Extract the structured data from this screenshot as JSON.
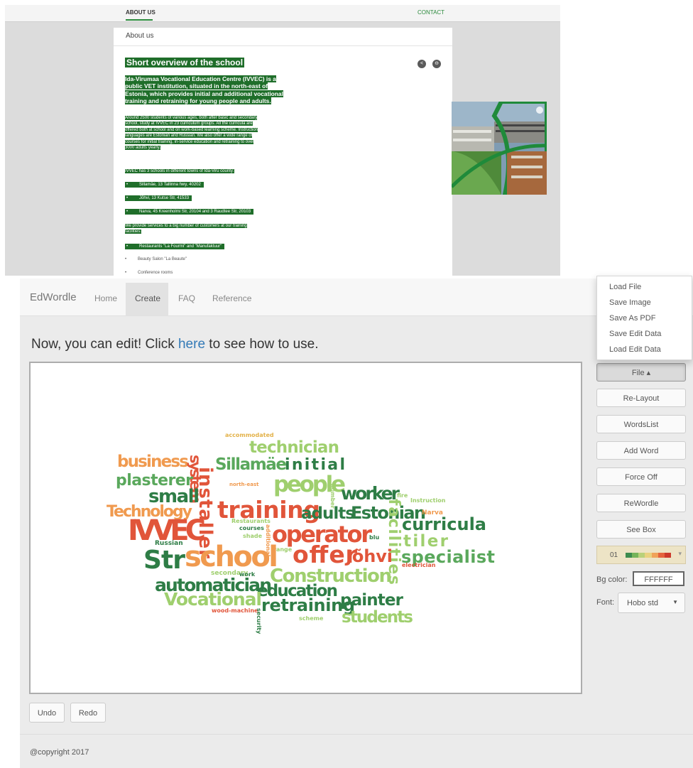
{
  "school_page": {
    "nav": {
      "about": "ABOUT US",
      "contact": "CONTACT"
    },
    "card_title": "About us",
    "heading": "Short overview of the school",
    "intro": [
      "Ida-Virumaa Vocational Education Centre (IVVEC) is a",
      "public VET institution, situated in the north-east of",
      "Estonia, which provides initial and additional vocational",
      "training and retraining for young people and adults."
    ],
    "paragraph1": [
      "Around 2500 students of various ages, both after basic and secondary",
      "school, study at IVVEC in 23 curriculum groups. All the curricula are",
      "offered both at school and on work-based learning scheme. Instruction",
      "languages are Estonian and Russian. We also offer a wide range of",
      "courses for initial training, in-service education and retraining to over",
      "3000 adults yearly."
    ],
    "schools_intro": "IVVEC has 3 schools in different towns of Ida-Viru county:",
    "schools": [
      "Sillamäe, 13 Tallinna hwy, 40202",
      "Jõhvi, 13 Kutse Str, 41533",
      "Narva, 45 Kreenholmi Str, 20104 and 3 Raudtee Str, 20103"
    ],
    "services_intro": [
      "We provide services to a big number of customers at our training",
      "facilities:"
    ],
    "services": [
      "Restaurants \"La Fourmi\" and \"Manufaktuur\"",
      "Beauty Salon \"La Beaute\"",
      "Conference rooms"
    ],
    "bullet": "•"
  },
  "edwordle": {
    "brand": "EdWordle",
    "nav": [
      "Home",
      "Create",
      "FAQ",
      "Reference"
    ],
    "active_nav": "Create",
    "lead_before": "Now, you can edit! Click ",
    "lead_link": "here",
    "lead_after": " to see how to use.",
    "file_menu": [
      "Load File",
      "Save Image",
      "Save As PDF",
      "Save Edit Data",
      "Load Edit Data"
    ],
    "buttons": {
      "file": "File ▴",
      "relayout": "Re-Layout",
      "wordslist": "WordsList",
      "add_word": "Add Word",
      "force_off": "Force Off",
      "rewordle": "ReWordle",
      "see_box": "See Box"
    },
    "palette": {
      "number": "01",
      "colors": [
        "#3d8c4f",
        "#76b45a",
        "#b9d17a",
        "#e9d27f",
        "#f0a35a",
        "#e4643e",
        "#cc3a2c"
      ],
      "caret": "▾"
    },
    "bg_color_label": "Bg color:",
    "bg_color_value": "FFFFFF",
    "font_label": "Font:",
    "font_value": "Hobo std",
    "font_caret": "▼",
    "undo": "Undo",
    "redo": "Redo",
    "copyright": "@copyright 2017",
    "word_colors": {
      "dark_green": "#2e7d46",
      "green": "#5aa85c",
      "light_green": "#9fcf6e",
      "orange": "#f09a4f",
      "red_orange": "#e1553a",
      "red": "#cc3b2b",
      "amber": "#e3b24a"
    },
    "words": [
      {
        "text": "accommodated",
        "color": "#e3b24a"
      },
      {
        "text": "technician",
        "color": "#9fcf6e"
      },
      {
        "text": "business",
        "color": "#f09a4f"
      },
      {
        "text": "system",
        "color": "#e1553a"
      },
      {
        "text": "Sillamäe",
        "color": "#5aa85c"
      },
      {
        "text": "initial",
        "color": "#2e7d46"
      },
      {
        "text": "plasterer",
        "color": "#5aa85c"
      },
      {
        "text": "installer",
        "color": "#e1553a"
      },
      {
        "text": "north-east",
        "color": "#f09a4f"
      },
      {
        "text": "people",
        "color": "#9fcf6e"
      },
      {
        "text": "number",
        "color": "#9fcf6e"
      },
      {
        "text": "small",
        "color": "#2e7d46"
      },
      {
        "text": "worker",
        "color": "#2e7d46"
      },
      {
        "text": "fire",
        "color": "#9fcf6e"
      },
      {
        "text": "Instruction",
        "color": "#9fcf6e"
      },
      {
        "text": "Technology",
        "color": "#f09a4f"
      },
      {
        "text": "training",
        "color": "#e1553a"
      },
      {
        "text": "adults",
        "color": "#2e7d46"
      },
      {
        "text": "Estonian",
        "color": "#2e7d46"
      },
      {
        "text": "Narva",
        "color": "#f09a4f"
      },
      {
        "text": "Restaurants",
        "color": "#9fcf6e"
      },
      {
        "text": "courses",
        "color": "#2e7d46"
      },
      {
        "text": "shade",
        "color": "#9fcf6e"
      },
      {
        "text": "IVVEC",
        "color": "#e1553a"
      },
      {
        "text": "operator",
        "color": "#e1553a"
      },
      {
        "text": "facilities",
        "color": "#9fcf6e"
      },
      {
        "text": "curricula",
        "color": "#2e7d46"
      },
      {
        "text": "blu",
        "color": "#2e7d46"
      },
      {
        "text": "Russian",
        "color": "#2e7d46"
      },
      {
        "text": "additional",
        "color": "#f09a4f"
      },
      {
        "text": "range",
        "color": "#9fcf6e"
      },
      {
        "text": "tiler",
        "color": "#9fcf6e"
      },
      {
        "text": "Str",
        "color": "#2e7d46"
      },
      {
        "text": "school",
        "color": "#f09a4f"
      },
      {
        "text": "offer",
        "color": "#e1553a"
      },
      {
        "text": "Jõhvi",
        "color": "#e1553a"
      },
      {
        "text": "specialist",
        "color": "#5aa85c"
      },
      {
        "text": "electrician",
        "color": "#e1553a"
      },
      {
        "text": "secondary",
        "color": "#9fcf6e"
      },
      {
        "text": "work",
        "color": "#2e7d46"
      },
      {
        "text": "Construction",
        "color": "#9fcf6e"
      },
      {
        "text": "automatician",
        "color": "#2e7d46"
      },
      {
        "text": "education",
        "color": "#2e7d46"
      },
      {
        "text": "Vocational",
        "color": "#9fcf6e"
      },
      {
        "text": "painter",
        "color": "#2e7d46"
      },
      {
        "text": "retraining",
        "color": "#2e7d46"
      },
      {
        "text": "wood-machine",
        "color": "#e1553a"
      },
      {
        "text": "security",
        "color": "#2e7d46"
      },
      {
        "text": "scheme",
        "color": "#9fcf6e"
      },
      {
        "text": "students",
        "color": "#9fcf6e"
      }
    ]
  }
}
